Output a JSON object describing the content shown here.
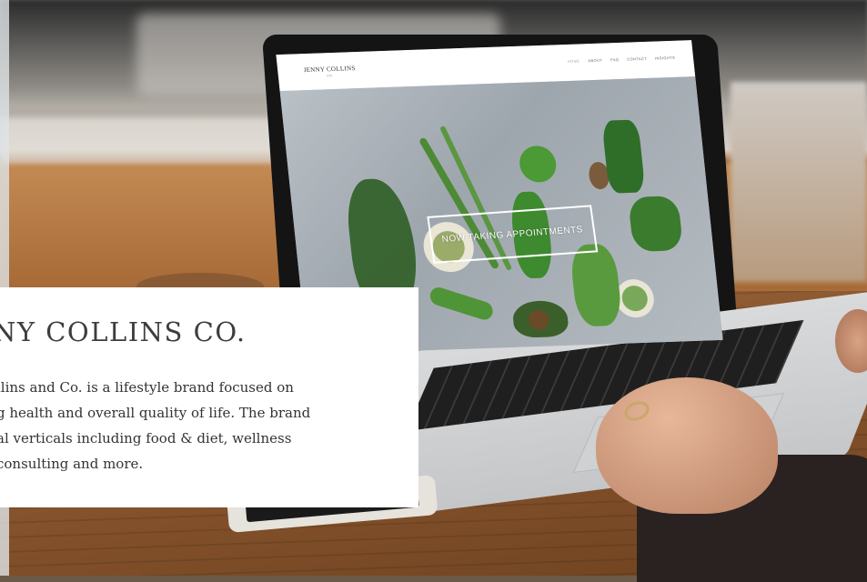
{
  "site": {
    "logo": {
      "name": "JENNY COLLINS",
      "sub": "CO."
    },
    "nav": [
      "HOME",
      "ABOUT",
      "FAQ",
      "CONTACT",
      "INSIGHTS"
    ],
    "hero_cta": "NOW TAKING APPOINTMENTS"
  },
  "card": {
    "title": "NY COLLINS CO.",
    "body_lines": [
      "llins and Co. is a lifestyle brand focused on",
      "g health and overall quality of life. The brand",
      "al verticals including food & diet, wellness",
      "consulting and more."
    ]
  },
  "colors": {
    "card_bg": "#ffffff",
    "title_text": "#3d3d3d",
    "body_text": "#333333",
    "wood": "#a06a3a"
  }
}
